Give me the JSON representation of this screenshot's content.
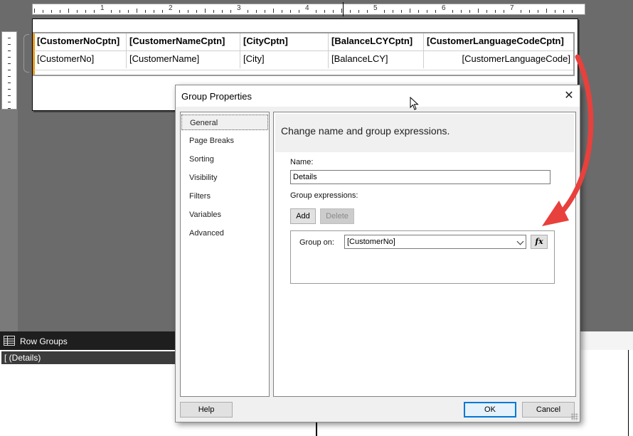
{
  "ruler": {
    "numbers": [
      "1",
      "2",
      "3",
      "4",
      "5",
      "6",
      "7"
    ]
  },
  "tablix": {
    "header": [
      "[CustomerNoCptn]",
      "[CustomerNameCptn]",
      "[CityCptn]",
      "[BalanceLCYCptn]",
      "[CustomerLanguageCodeCptn]"
    ],
    "details": [
      "[CustomerNo]",
      "[CustomerName]",
      "[City]",
      "[BalanceLCY]",
      "[CustomerLanguageCode]"
    ]
  },
  "row_groups": {
    "title": "Row Groups",
    "item": "[ (Details)"
  },
  "dialog": {
    "title": "Group Properties",
    "close_glyph": "✕",
    "nav": [
      "General",
      "Page Breaks",
      "Sorting",
      "Visibility",
      "Filters",
      "Variables",
      "Advanced"
    ],
    "selected_nav": "General",
    "heading": "Change name and group expressions.",
    "name_label": "Name:",
    "name_value": "Details",
    "group_expressions_label": "Group expressions:",
    "add_label": "Add",
    "delete_label": "Delete",
    "group_on_label": "Group on:",
    "group_on_value": "[CustomerNo]",
    "fx_label": "fx",
    "help_label": "Help",
    "ok_label": "OK",
    "cancel_label": "Cancel"
  },
  "colors": {
    "arrow": "#e8403c",
    "accent": "#0078d7",
    "tablix_handle": "#e89a1a"
  }
}
